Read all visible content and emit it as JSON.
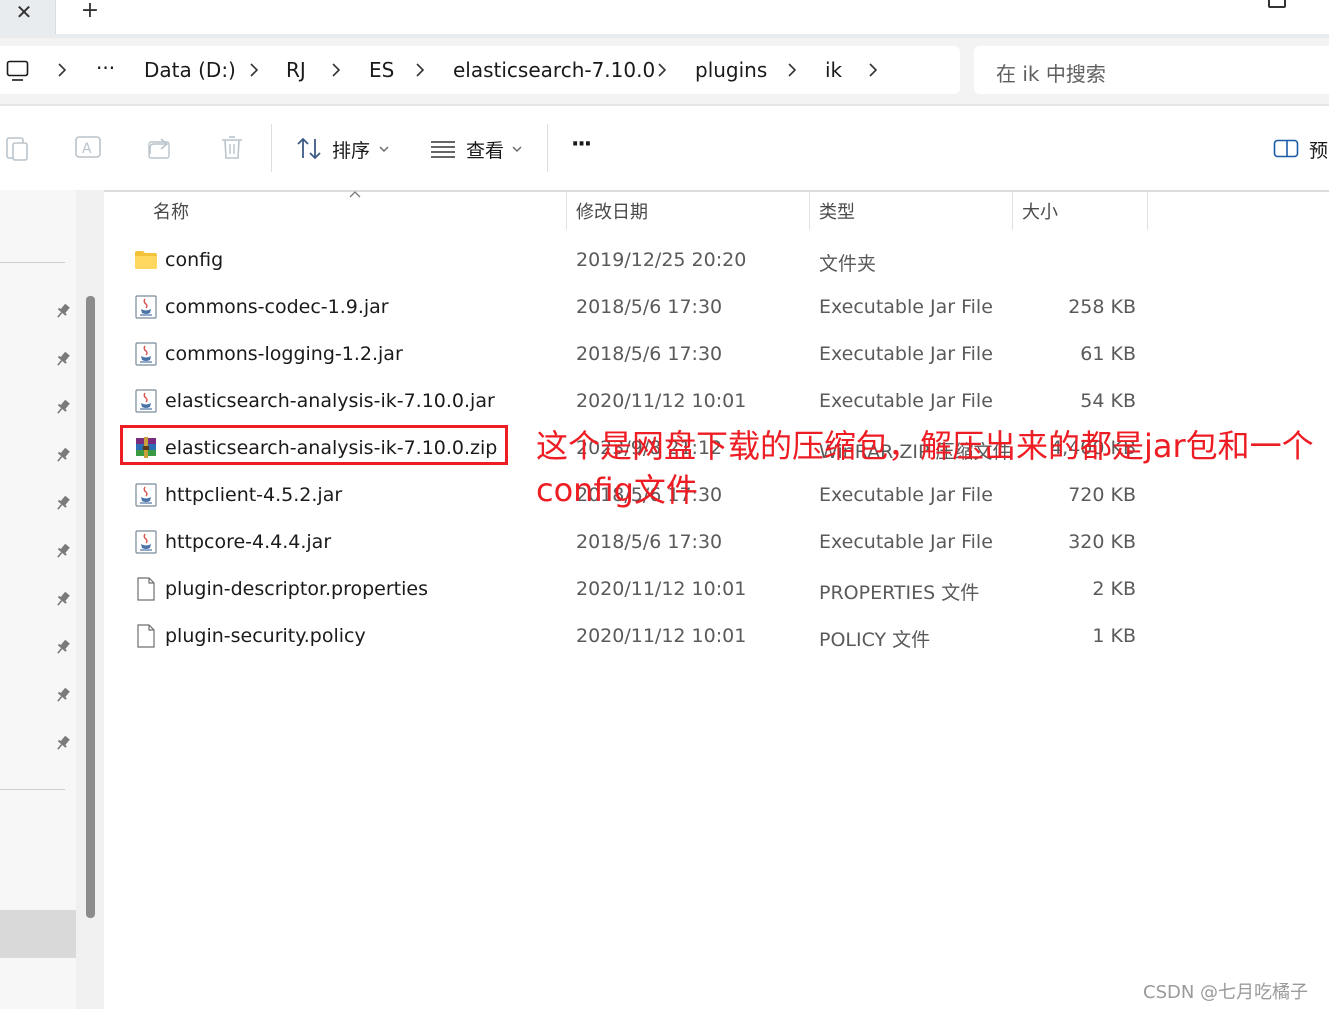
{
  "window": {
    "close_glyph": "✕",
    "new_tab_glyph": "+"
  },
  "address_bar": {
    "overflow": "···",
    "breadcrumbs": [
      "Data (D:)",
      "RJ",
      "ES",
      "elasticsearch-7.10.0",
      "plugins",
      "ik"
    ],
    "search_placeholder": "在 ik 中搜索"
  },
  "toolbar": {
    "sort_label": "排序",
    "view_label": "查看",
    "more_label": "···",
    "preview_label": "预"
  },
  "columns": {
    "name": "名称",
    "date": "修改日期",
    "type": "类型",
    "size": "大小"
  },
  "files": [
    {
      "icon": "folder-icon",
      "name": "config",
      "date": "2019/12/25 20:20",
      "type": "文件夹",
      "size": ""
    },
    {
      "icon": "jar-icon",
      "name": "commons-codec-1.9.jar",
      "date": "2018/5/6 17:30",
      "type": "Executable Jar File",
      "size": "258 KB"
    },
    {
      "icon": "jar-icon",
      "name": "commons-logging-1.2.jar",
      "date": "2018/5/6 17:30",
      "type": "Executable Jar File",
      "size": "61 KB"
    },
    {
      "icon": "jar-icon",
      "name": "elasticsearch-analysis-ik-7.10.0.jar",
      "date": "2020/11/12 10:01",
      "type": "Executable Jar File",
      "size": "54 KB"
    },
    {
      "icon": "zip-icon",
      "name": "elasticsearch-analysis-ik-7.10.0.zip",
      "date": "2023/9/8 21:12",
      "type": "WinRAR ZIP 压缩文件",
      "size": "4,400 KB"
    },
    {
      "icon": "jar-icon",
      "name": "httpclient-4.5.2.jar",
      "date": "2018/5/6 17:30",
      "type": "Executable Jar File",
      "size": "720 KB"
    },
    {
      "icon": "jar-icon",
      "name": "httpcore-4.4.4.jar",
      "date": "2018/5/6 17:30",
      "type": "Executable Jar File",
      "size": "320 KB"
    },
    {
      "icon": "file-icon",
      "name": "plugin-descriptor.properties",
      "date": "2020/11/12 10:01",
      "type": "PROPERTIES 文件",
      "size": "2 KB"
    },
    {
      "icon": "file-icon",
      "name": "plugin-security.policy",
      "date": "2020/11/12 10:01",
      "type": "POLICY 文件",
      "size": "1 KB"
    }
  ],
  "annotation": {
    "text": "这个是网盘下载的压缩包，解压出来的都是jar包和一个config文件",
    "color": "#ee1d24"
  },
  "watermark": "CSDN @七月吃橘子"
}
